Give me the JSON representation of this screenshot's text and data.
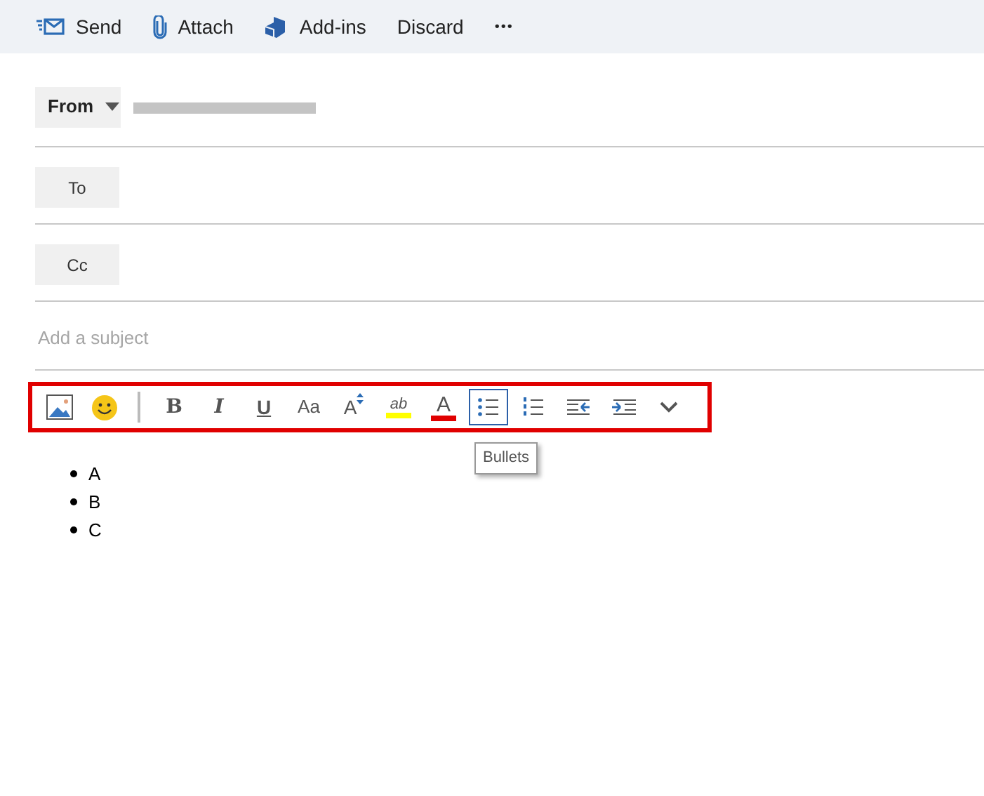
{
  "command_bar": [
    {
      "kind": "send",
      "label": "Send"
    },
    {
      "kind": "attach",
      "label": "Attach"
    },
    {
      "kind": "addins",
      "label": "Add-ins"
    },
    {
      "kind": "plain",
      "label": "Discard"
    },
    {
      "kind": "more",
      "label": "•••"
    }
  ],
  "from": {
    "label": "From",
    "address_redacted": true
  },
  "recipients": [
    {
      "label": "To"
    },
    {
      "label": "Cc"
    }
  ],
  "subject": {
    "placeholder": "Add a subject"
  },
  "format_toolbar": [
    {
      "kind": "picture",
      "selected": false
    },
    {
      "kind": "emoji",
      "selected": false
    },
    {
      "kind": "separator"
    },
    {
      "kind": "bold",
      "label": "B",
      "selected": false
    },
    {
      "kind": "italic",
      "label": "I",
      "selected": false
    },
    {
      "kind": "underline",
      "label": "U",
      "selected": false
    },
    {
      "kind": "case",
      "label": "Aa",
      "selected": false
    },
    {
      "kind": "size",
      "label": "A",
      "selected": false
    },
    {
      "kind": "highlight",
      "label": "ab",
      "color": "#ffff00",
      "selected": false
    },
    {
      "kind": "fontcolor",
      "label": "A",
      "color": "#e00000",
      "selected": false
    },
    {
      "kind": "bullets",
      "selected": true
    },
    {
      "kind": "numbering",
      "selected": false
    },
    {
      "kind": "outdent",
      "selected": false
    },
    {
      "kind": "indent",
      "selected": false
    },
    {
      "kind": "more",
      "selected": false
    }
  ],
  "tooltip": "Bullets",
  "body_list": [
    "A",
    "B",
    "C"
  ]
}
